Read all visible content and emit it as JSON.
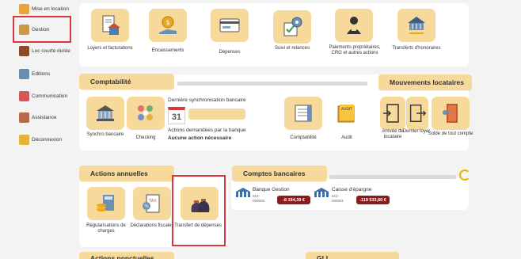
{
  "sidebar": {
    "items": [
      {
        "label": "Mise en location",
        "icon": "house-key-icon",
        "color": "#e8a33a"
      },
      {
        "label": "Gestion",
        "icon": "gestion-icon",
        "color": "#c99a4a"
      },
      {
        "label": "Loc courte durée",
        "icon": "suitcase-icon",
        "color": "#8b4a2a"
      },
      {
        "label": "Editions",
        "icon": "document-icon",
        "color": "#6a8fb0"
      },
      {
        "label": "Communication",
        "icon": "chat-icon",
        "color": "#d05a5a"
      },
      {
        "label": "Assistance",
        "icon": "support-icon",
        "color": "#b56b4a"
      },
      {
        "label": "Déconnexion",
        "icon": "logout-icon",
        "color": "#e2b43a"
      }
    ]
  },
  "top_tiles": [
    {
      "label": "Loyers et facturations",
      "icon": "rent-invoice-icon"
    },
    {
      "label": "Encaissements",
      "icon": "coin-hand-icon"
    },
    {
      "label": "Dépenses",
      "icon": "expenses-icon"
    },
    {
      "label": "Suivi et relances",
      "icon": "gear-check-icon"
    },
    {
      "label": "Paiements propriétaires, CRG et autres actions",
      "icon": "owner-payment-icon"
    },
    {
      "label": "Transferts d'honoraires",
      "icon": "transfer-fees-icon"
    }
  ],
  "comptabilite": {
    "title": "Comptabilité",
    "sync_title": "Dernière synchronisation bancaire",
    "calendar_day": "31",
    "actions_title": "Actions demandées par la banque",
    "actions_value": "Aucune action nécessaire",
    "tiles": [
      {
        "label": "Synchro bancaire",
        "icon": "bank-sync-icon"
      },
      {
        "label": "Checking",
        "icon": "checking-dots-icon"
      },
      {
        "label": "Comptabilité",
        "icon": "ledger-icon"
      },
      {
        "label": "Audit",
        "icon": "audit-folder-icon",
        "folder_text": "AUDIT"
      }
    ]
  },
  "mouvements": {
    "title": "Mouvements locataires",
    "tiles": [
      {
        "label": "Arrivée de locataire",
        "icon": "door-enter-icon"
      },
      {
        "label": "Dernier loyer",
        "icon": "door-exit-icon"
      },
      {
        "label": "Solde de tout compte",
        "icon": "door-key-icon"
      }
    ]
  },
  "actions_annuelles": {
    "title": "Actions annuelles",
    "tiles": [
      {
        "label": "Régularisations de charges",
        "icon": "calculator-coins-icon"
      },
      {
        "label": "Déclarations fiscales",
        "icon": "tax-form-icon",
        "tax_text": "TAX"
      },
      {
        "label": "Transfert de dépenses",
        "icon": "money-bags-icon"
      }
    ]
  },
  "comptes_bancaires": {
    "title": "Comptes bancaires",
    "accounts": [
      {
        "name": "Banque Gestion",
        "code1": "512-",
        "code2": "000005",
        "balance": "-8 194,39 €"
      },
      {
        "name": "Caisse d'épargne",
        "code1": "512-",
        "code2": "000001",
        "balance": "-119 533,60 €"
      }
    ]
  },
  "bottom": {
    "left_title": "Actions ponctuelles",
    "right_title": "GLI"
  },
  "colors": {
    "accent": "#f7d99b",
    "highlight": "#d9363e",
    "badge": "#8e1b1b",
    "refresh": "#e8b400"
  }
}
